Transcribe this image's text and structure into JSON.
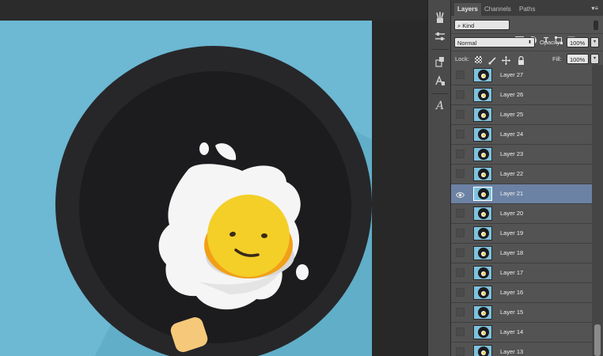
{
  "panel": {
    "tabs": [
      "Layers",
      "Channels",
      "Paths"
    ],
    "filter_label": "Kind",
    "blend_mode": "Normal",
    "opacity_label": "Opacity:",
    "opacity_value": "100%",
    "lock_label": "Lock:",
    "fill_label": "Fill:",
    "fill_value": "100%",
    "menu_glyph": "▾≡"
  },
  "layers": [
    {
      "name": "Layer 27",
      "visible": false,
      "selected": false
    },
    {
      "name": "Layer 26",
      "visible": false,
      "selected": false
    },
    {
      "name": "Layer 25",
      "visible": false,
      "selected": false
    },
    {
      "name": "Layer 24",
      "visible": false,
      "selected": false
    },
    {
      "name": "Layer 23",
      "visible": false,
      "selected": false
    },
    {
      "name": "Layer 22",
      "visible": false,
      "selected": false
    },
    {
      "name": "Layer 21",
      "visible": true,
      "selected": true
    },
    {
      "name": "Layer 20",
      "visible": false,
      "selected": false
    },
    {
      "name": "Layer 19",
      "visible": false,
      "selected": false
    },
    {
      "name": "Layer 18",
      "visible": false,
      "selected": false
    },
    {
      "name": "Layer 17",
      "visible": false,
      "selected": false
    },
    {
      "name": "Layer 16",
      "visible": false,
      "selected": false
    },
    {
      "name": "Layer 15",
      "visible": false,
      "selected": false
    },
    {
      "name": "Layer 14",
      "visible": false,
      "selected": false
    },
    {
      "name": "Layer 13",
      "visible": false,
      "selected": false
    }
  ],
  "tools": [
    "brush-settings-icon",
    "adjust-sliders-icon",
    "clone-source-icon",
    "character-style-icon",
    "glyph-a-icon"
  ],
  "colors": {
    "canvas_bg": "#6db8d3",
    "pan_dark": "#1c1c1e",
    "pan_rim": "#27272a",
    "yolk": "#f3cf28",
    "selection": "#6c82a4"
  }
}
